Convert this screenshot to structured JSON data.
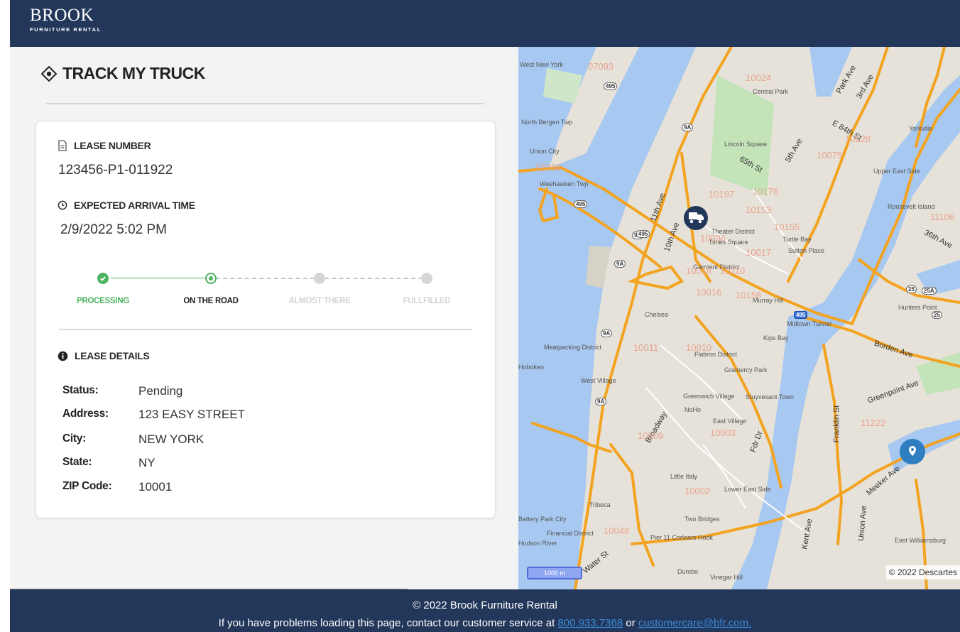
{
  "header": {
    "logo_main": "BROOK",
    "logo_sub": "FURNITURE RENTAL"
  },
  "page": {
    "title": "TRACK MY TRUCK"
  },
  "lease_number": {
    "label": "LEASE NUMBER",
    "value": "123456-P1-011922"
  },
  "arrival": {
    "label": "EXPECTED ARRIVAL TIME",
    "value": "2/9/2022 5:02 PM"
  },
  "progress": {
    "steps": [
      {
        "label": "PROCESSING",
        "state": "done"
      },
      {
        "label": "ON THE ROAD",
        "state": "current"
      },
      {
        "label": "ALMOST THERE",
        "state": "pending"
      },
      {
        "label": "FULLFILLED",
        "state": "pending"
      }
    ]
  },
  "lease_details": {
    "label": "LEASE DETAILS",
    "rows": [
      {
        "key": "Status:",
        "value": "Pending"
      },
      {
        "key": "Address:",
        "value": "123 EASY STREET"
      },
      {
        "key": "City:",
        "value": "NEW YORK"
      },
      {
        "key": "State:",
        "value": "NY"
      },
      {
        "key": "ZIP Code:",
        "value": "10001"
      }
    ]
  },
  "map": {
    "copyright": "© 2022 Descartes",
    "scale": "1000 m",
    "labels": {
      "west_new_york": "West New York",
      "north_bergen": "North Bergen Twp",
      "union_city": "Union City",
      "weehawken": "Weehawken Twp",
      "eleventh_ave": "11th Ave",
      "tenth_ave": "10th Ave",
      "fifth_ave": "5th Ave",
      "park_ave": "Park Ave",
      "third_ave": "3rd Ave",
      "e84": "E 84th St",
      "sixtyfifth": "65th St",
      "thirtysixth": "36th Ave",
      "borden": "Borden Ave",
      "greenpoint": "Greenpoint Ave",
      "franklin": "Franklin St",
      "meeker": "Meeker Ave",
      "union_ave": "Union Ave",
      "kent": "Kent Ave",
      "water": "Water St",
      "broadway": "Broadway",
      "fdr": "Fdr Dr",
      "chelsea": "Chelsea",
      "hoboken": "Hoboken",
      "central_park": "Central Park",
      "times_square": "Times Square",
      "garment": "Garment District",
      "murray_hill": "Murray Hill",
      "gramercy": "Gramercy Park",
      "west_village": "West Village",
      "greenwich": "Greenwich Village",
      "east_village": "East Village",
      "little_italy": "Little Italy",
      "lower_east": "Lower East Side",
      "two_bridges": "Two Bridges",
      "dumbo": "Dumbo",
      "tribeca": "Tribeca",
      "financial": "Financial District",
      "battery": "Battery Park City",
      "hudson": "Hudson River",
      "pier": "Pier 11 Corlears Hook",
      "hunters": "Hunters Point",
      "roosevelt": "Roosevelt Island",
      "yorkville": "Yorkville",
      "upper_east": "Upper East Side",
      "lincoln": "Lincoln Square",
      "noho": "NoHo",
      "east_williamsburg": "East Williamsburg",
      "meatpacking": "Meatpacking District",
      "kips_bay": "Kips Bay",
      "stuyvesant": "Stuyvesant Town",
      "flatiron": "Flatiron District",
      "midtown_tunnel": "Midtown Tunnel",
      "vinegar_hill": "Vinegar Hill",
      "turtle_bay": "Turtle Bay",
      "sutton": "Sutton Place",
      "theater": "Theater District"
    },
    "zips": [
      "10024",
      "10128",
      "10075",
      "10197",
      "10176",
      "10153",
      "10155",
      "10036",
      "10017",
      "10018",
      "10110",
      "10016",
      "10158",
      "10011",
      "10010",
      "10003",
      "10009",
      "10002",
      "11222",
      "11106",
      "10048",
      "07093",
      "07086"
    ],
    "shields": [
      "495",
      "9A",
      "495",
      "9A",
      "9A",
      "9A",
      "9A",
      "495",
      "25",
      "25A",
      "25",
      "495"
    ]
  },
  "footer": {
    "copyright": "© 2022 Brook Furniture Rental",
    "help_prefix": "If you have problems loading this page, contact our customer service at ",
    "phone": "800.933.7368",
    "or": " or ",
    "email": "customercare@bfr.com."
  },
  "colors": {
    "navy": "#22375a",
    "green": "#4cb35e",
    "map_water": "#a7c8f0",
    "map_road": "#f3a31f",
    "pin_blue": "#2f7ec2"
  }
}
